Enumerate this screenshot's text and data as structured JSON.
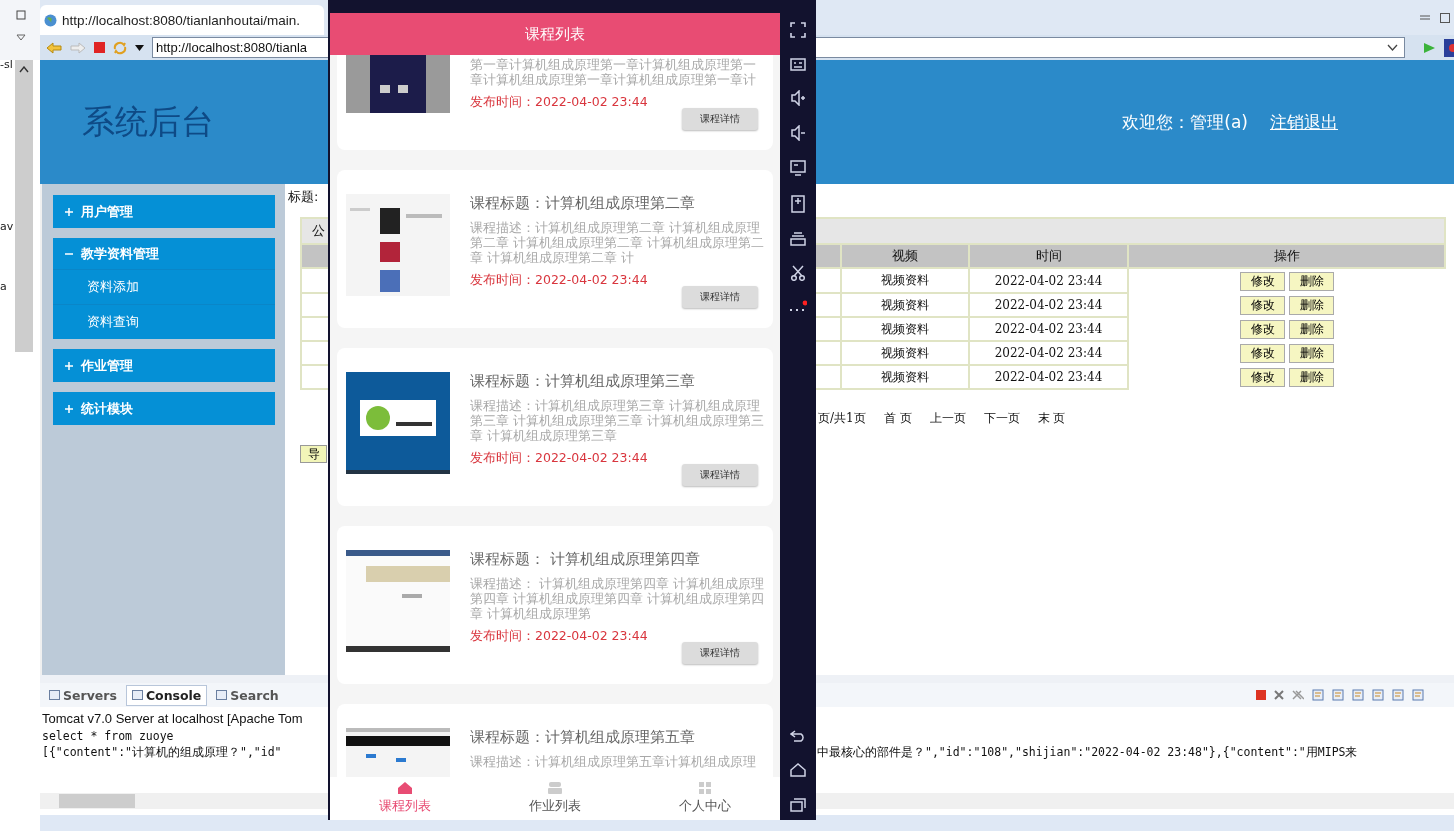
{
  "ide": {
    "explorer_fragments": [
      "-sl",
      "av",
      "a"
    ],
    "browser": {
      "tab_title": "http://localhost:8080/tianlanhoutai/main.",
      "address": "http://localhost:8080/tianla"
    },
    "site": {
      "title": "系统后台",
      "welcome": "欢迎您：管理(a)",
      "logout": "注销退出",
      "menu": [
        {
          "label": "用户管理",
          "expanded": false
        },
        {
          "label": "教学资料管理",
          "expanded": true,
          "children": [
            "资料添加",
            "资料查询"
          ]
        },
        {
          "label": "作业管理",
          "expanded": false
        },
        {
          "label": "统计模块",
          "expanded": false
        }
      ],
      "search_label": "标题:",
      "table": {
        "title": "公",
        "columns": [
          "视频",
          "时间",
          "操作"
        ],
        "rows": [
          {
            "video": "视频资料",
            "time": "2022-04-02 23:44",
            "actions": [
              "修改",
              "删除"
            ]
          },
          {
            "video": "视频资料",
            "time": "2022-04-02 23:44",
            "actions": [
              "修改",
              "删除"
            ]
          },
          {
            "video": "视频资料",
            "time": "2022-04-02 23:44",
            "actions": [
              "修改",
              "删除"
            ]
          },
          {
            "video": "视频资料",
            "time": "2022-04-02 23:44",
            "actions": [
              "修改",
              "删除"
            ]
          },
          {
            "video": "视频资料",
            "time": "2022-04-02 23:44",
            "actions": [
              "修改",
              "删除"
            ]
          }
        ]
      },
      "pagination": [
        "页/共1页",
        "首 页",
        "上一页",
        "下一页",
        "末 页"
      ],
      "export_button": "导"
    },
    "console": {
      "tabs": [
        {
          "label": "Servers",
          "selected": false
        },
        {
          "label": "Console",
          "selected": true
        },
        {
          "label": "Search",
          "selected": false
        }
      ],
      "server_line": "Tomcat v7.0 Server at localhost [Apache Tom",
      "lines": [
        {
          "left": "select * from zuoye"
        },
        {
          "left": "[{\"content\":\"计算机的组成原理？\",\"id\"",
          "right": "中最核心的部件是？\",\"id\":\"108\",\"shijian\":\"2022-04-02 23:48\"},{\"content\":\"用MIPS来"
        }
      ]
    }
  },
  "emulator": {
    "app_title": "课程列表",
    "courses": [
      {
        "kind": "partial",
        "description": "第一章计算机组成原理第一章计算机组成原理第一章计算机组成原理第一章计算机组成原理第一章计",
        "date_label": "发布时间：",
        "date": "2022-04-02 23:44",
        "button": "课程详情"
      },
      {
        "kind": "full",
        "title": "课程标题：计算机组成原理第二章",
        "description": "课程描述：计算机组成原理第二章 计算机组成原理第二章 计算机组成原理第二章 计算机组成原理第二章 计算机组成原理第二章 计",
        "date_label": "发布时间：",
        "date": "2022-04-02 23:44",
        "button": "课程详情"
      },
      {
        "kind": "full",
        "title": "课程标题：计算机组成原理第三章",
        "description": "课程描述：计算机组成原理第三章 计算机组成原理第三章 计算机组成原理第三章 计算机组成原理第三章 计算机组成原理第三章",
        "date_label": "发布时间：",
        "date": "2022-04-02 23:44",
        "button": "课程详情"
      },
      {
        "kind": "full",
        "title": "课程标题： 计算机组成原理第四章",
        "description": "课程描述： 计算机组成原理第四章 计算机组成原理第四章 计算机组成原理第四章 计算机组成原理第四章 计算机组成原理第",
        "date_label": "发布时间：",
        "date": "2022-04-02 23:44",
        "button": "课程详情"
      },
      {
        "kind": "cut",
        "title": "课程标题：计算机组成原理第五章",
        "description": "课程描述：计算机组成原理第五章计算机组成原理"
      }
    ],
    "tabs": [
      {
        "label": "课程列表",
        "selected": true
      },
      {
        "label": "作业列表",
        "selected": false
      },
      {
        "label": "个人中心",
        "selected": false
      }
    ]
  }
}
